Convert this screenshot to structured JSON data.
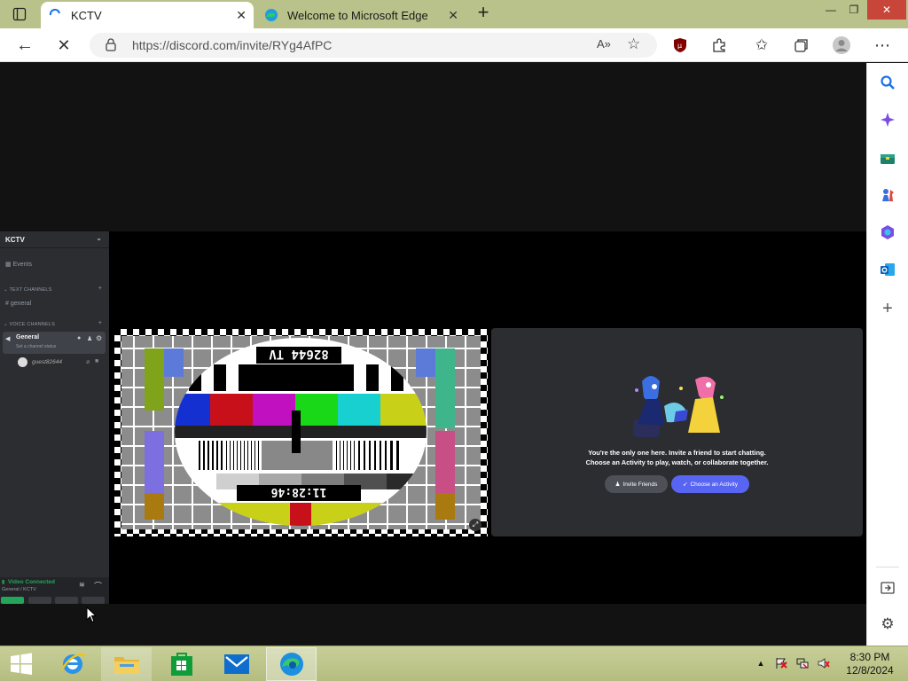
{
  "browser": {
    "tabs": [
      {
        "label": "KCTV",
        "active": true
      },
      {
        "label": "Welcome to Microsoft Edge",
        "active": false
      }
    ],
    "url": "https://discord.com/invite/RYg4AfPC"
  },
  "discord": {
    "server_name": "KCTV",
    "events_label": "Events",
    "text_category": "TEXT CHANNELS",
    "text_channel": "general",
    "voice_category": "VOICE CHANNELS",
    "voice_channel": "General",
    "channel_status": "Set a channel status",
    "voice_user": "guest82644",
    "connection_status": "Video Connected",
    "connection_location": "General / KCTV",
    "tv_card_name": "82644 TV",
    "tv_card_time": "11:28:46",
    "empty_line1": "You're the only one here. Invite a friend to start chatting.",
    "empty_line2": "Choose an Activity to play, watch, or collaborate together.",
    "invite_button": "Invite Friends",
    "activity_button": "Choose an Activity"
  },
  "taskbar": {
    "time": "8:30 PM",
    "date": "12/8/2024"
  },
  "colors": {
    "discord_blurple": "#5865f2",
    "discord_green": "#23a55a",
    "titlebar": "#b9c28a"
  }
}
